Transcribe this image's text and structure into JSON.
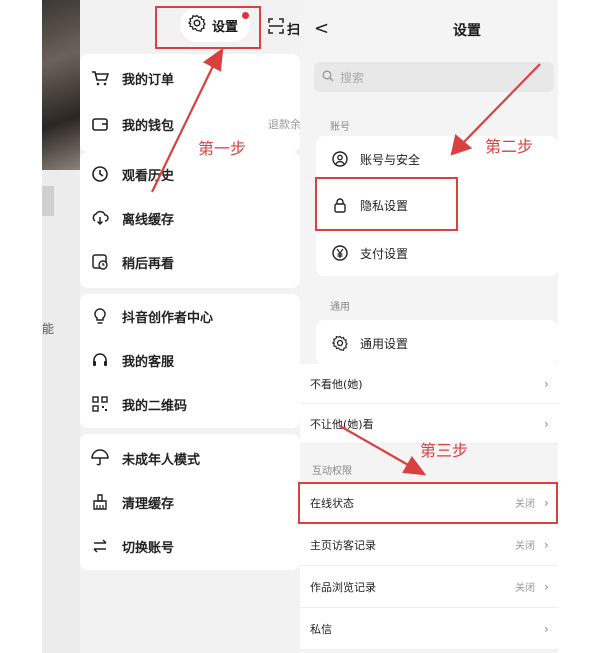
{
  "left_strip": {
    "side_label": "能"
  },
  "left_menu": {
    "settings_label": "设置",
    "scan_label": "扫",
    "group1": [
      {
        "label": "我的订单",
        "icon": "cart-icon"
      },
      {
        "label": "我的钱包",
        "icon": "wallet-icon",
        "right": "退款余"
      }
    ],
    "group2": [
      {
        "label": "观看历史",
        "icon": "clock-icon"
      },
      {
        "label": "离线缓存",
        "icon": "download-icon"
      },
      {
        "label": "稍后再看",
        "icon": "watch-later-icon"
      }
    ],
    "group3": [
      {
        "label": "抖音创作者中心",
        "icon": "bulb-icon"
      },
      {
        "label": "我的客服",
        "icon": "headset-icon"
      },
      {
        "label": "我的二维码",
        "icon": "qrcode-icon"
      }
    ],
    "group4": [
      {
        "label": "未成年人模式",
        "icon": "umbrella-icon"
      },
      {
        "label": "清理缓存",
        "icon": "broom-icon"
      },
      {
        "label": "切换账号",
        "icon": "switch-icon"
      }
    ]
  },
  "settings_page": {
    "back": "<",
    "title": "设置",
    "search_placeholder": "搜索",
    "account_section": "账号",
    "account_items": [
      {
        "label": "账号与安全",
        "icon": "account-icon"
      },
      {
        "label": "隐私设置",
        "icon": "lock-icon"
      },
      {
        "label": "支付设置",
        "icon": "yen-icon"
      }
    ],
    "general_section": "通用",
    "general_item": {
      "label": "通用设置",
      "icon": "gear-icon"
    },
    "privacy_rows": [
      {
        "label": "不看他(她)"
      },
      {
        "label": "不让他(她)看"
      }
    ],
    "interaction_section": "互动权限",
    "interaction_rows": [
      {
        "label": "在线状态",
        "status": "关闭"
      },
      {
        "label": "主页访客记录",
        "status": "关闭"
      },
      {
        "label": "作品浏览记录",
        "status": "关闭"
      },
      {
        "label": "私信",
        "status": ""
      }
    ]
  },
  "annotations": {
    "step1": "第一步",
    "step2": "第二步",
    "step3": "第三步",
    "color": "#d94040"
  }
}
